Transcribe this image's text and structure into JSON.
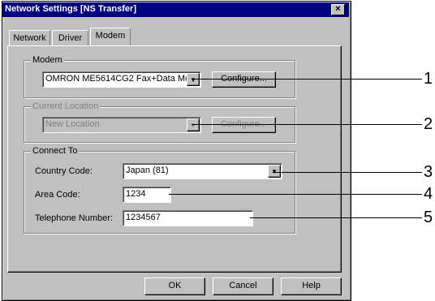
{
  "window": {
    "title": "Network Settings [NS Transfer]",
    "close": "×"
  },
  "tabs": [
    {
      "label": "Network"
    },
    {
      "label": "Driver"
    },
    {
      "label": "Modem"
    }
  ],
  "modem": {
    "group_label": "Modem",
    "selected": "OMRON ME5614CG2 Fax+Data Mc",
    "configure": "Configure..."
  },
  "location": {
    "group_label": "Current Location",
    "selected": "New Location",
    "configure": "Configure..."
  },
  "connect": {
    "group_label": "Connect To",
    "country_label": "Country Code:",
    "country_value": "Japan (81)",
    "area_label": "Area Code:",
    "area_value": "1234",
    "phone_label": "Telephone Number:",
    "phone_value": "1234567"
  },
  "buttons": {
    "ok": "OK",
    "cancel": "Cancel",
    "help": "Help"
  },
  "callouts": [
    "1",
    "2",
    "3",
    "4",
    "5"
  ],
  "icons": {
    "dropdown": "▼",
    "close": "×"
  }
}
